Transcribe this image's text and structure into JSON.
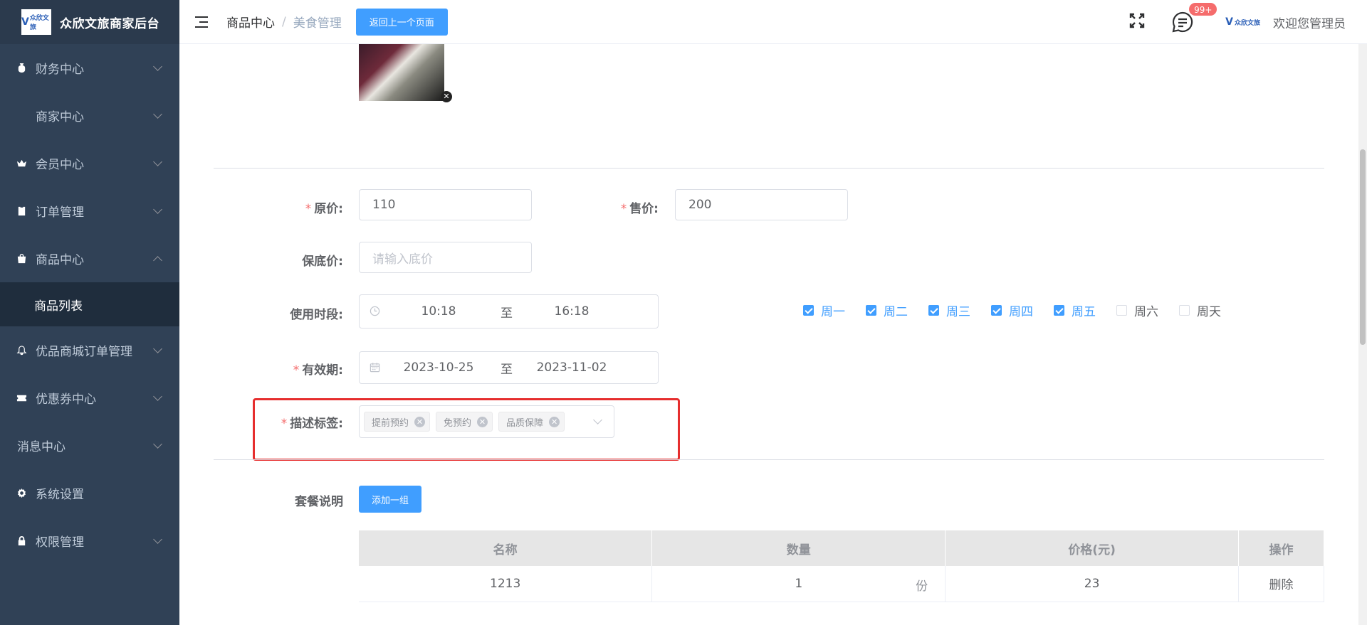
{
  "app": {
    "logo_text": "众欣文旅",
    "title": "众欣文旅商家后台"
  },
  "sidebar": {
    "items": [
      {
        "label": "财务中心",
        "icon": "money-bag-icon"
      },
      {
        "label": "商家中心",
        "icon": "store-icon"
      },
      {
        "label": "会员中心",
        "icon": "crown-icon"
      },
      {
        "label": "订单管理",
        "icon": "clipboard-icon"
      },
      {
        "label": "商品中心",
        "icon": "shopping-bag-icon"
      },
      {
        "label": "优品商城订单管理",
        "icon": "bell-icon"
      },
      {
        "label": "优惠券中心",
        "icon": "ticket-icon"
      },
      {
        "label": "消息中心",
        "icon": ""
      },
      {
        "label": "系统设置",
        "icon": "gear-icon"
      },
      {
        "label": "权限管理",
        "icon": "lock-icon"
      }
    ],
    "active_sub": "商品列表"
  },
  "header": {
    "breadcrumb_1": "商品中心",
    "breadcrumb_sep": "/",
    "breadcrumb_2": "美食管理",
    "back_button": "返回上一个页面",
    "badge": "99+",
    "welcome": "欢迎您管理员"
  },
  "form": {
    "original_price_label": "原价:",
    "original_price": "110",
    "sale_price_label": "售价:",
    "sale_price": "200",
    "floor_price_label": "保底价:",
    "floor_price_placeholder": "请输入底价",
    "use_time_label": "使用时段:",
    "use_time_start": "10:18",
    "range_sep": "至",
    "use_time_end": "16:18",
    "weekdays": [
      {
        "label": "周一",
        "checked": true
      },
      {
        "label": "周二",
        "checked": true
      },
      {
        "label": "周三",
        "checked": true
      },
      {
        "label": "周四",
        "checked": true
      },
      {
        "label": "周五",
        "checked": true
      },
      {
        "label": "周六",
        "checked": false
      },
      {
        "label": "周天",
        "checked": false
      }
    ],
    "validity_label": "有效期:",
    "validity_start": "2023-10-25",
    "validity_end": "2023-11-02",
    "tags_label": "描述标签:",
    "tags": [
      "提前预约",
      "免预约",
      "品质保障"
    ],
    "package_label": "套餐说明",
    "add_group_button": "添加一组"
  },
  "table": {
    "headers": [
      "名称",
      "数量",
      "价格(元)",
      "操作"
    ],
    "rows": [
      {
        "name": "1213",
        "qty": "1",
        "unit": "份",
        "price": "23",
        "action": "删除"
      }
    ]
  }
}
